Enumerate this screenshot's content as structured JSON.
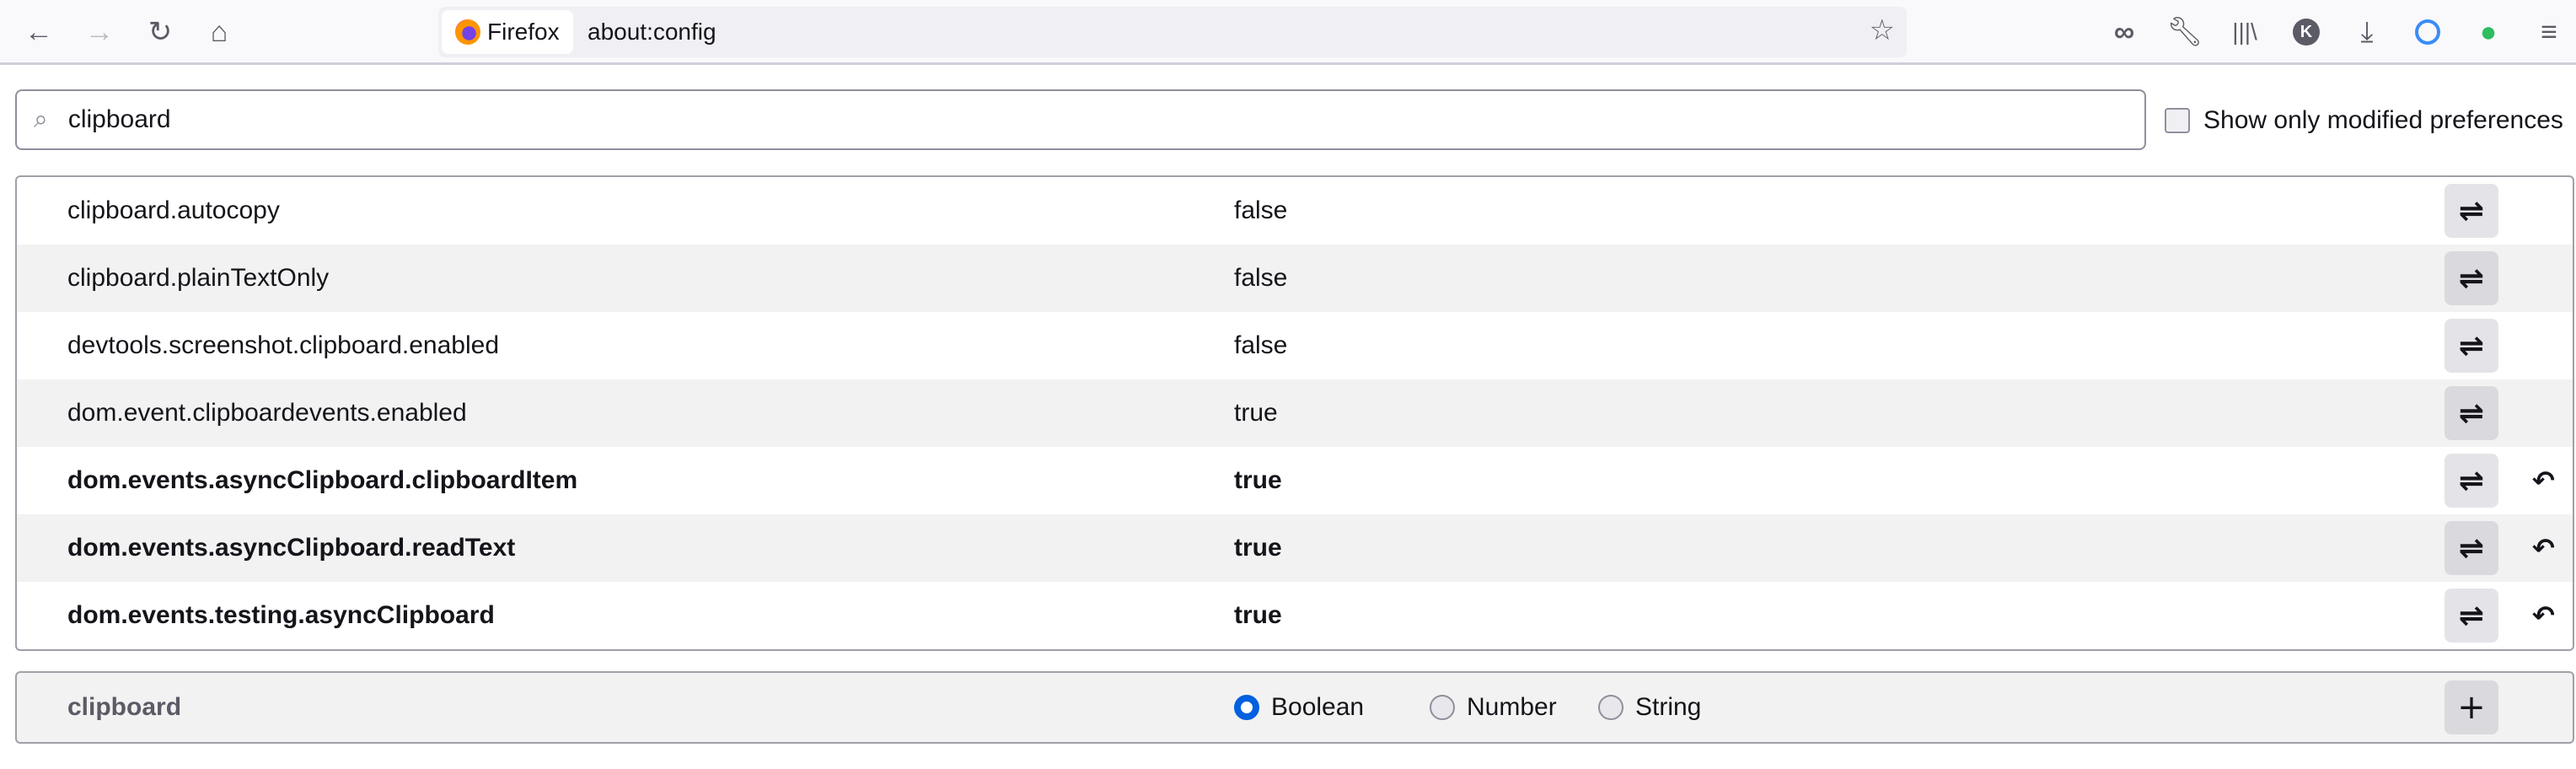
{
  "toolbar": {
    "identity_label": "Firefox",
    "url": "about:config",
    "nav_icons": [
      "back-icon",
      "forward-icon",
      "reload-icon",
      "home-icon"
    ],
    "right_icons": [
      "private-mask-icon",
      "wrench-icon",
      "library-icon",
      "k-extension-icon",
      "download-icon",
      "1password-icon",
      "evernote-icon",
      "menu-icon"
    ],
    "k_label": "K"
  },
  "search": {
    "value": "clipboard"
  },
  "modified_filter": {
    "label": "Show only modified preferences",
    "checked": false
  },
  "prefs": [
    {
      "name": "clipboard.autocopy",
      "value": "false",
      "modified": false
    },
    {
      "name": "clipboard.plainTextOnly",
      "value": "false",
      "modified": false
    },
    {
      "name": "devtools.screenshot.clipboard.enabled",
      "value": "false",
      "modified": false
    },
    {
      "name": "dom.event.clipboardevents.enabled",
      "value": "true",
      "modified": false
    },
    {
      "name": "dom.events.asyncClipboard.clipboardItem",
      "value": "true",
      "modified": true
    },
    {
      "name": "dom.events.asyncClipboard.readText",
      "value": "true",
      "modified": true
    },
    {
      "name": "dom.events.testing.asyncClipboard",
      "value": "true",
      "modified": true
    }
  ],
  "new_pref": {
    "name": "clipboard",
    "types": [
      "Boolean",
      "Number",
      "String"
    ],
    "selected": "Boolean"
  },
  "colors": {
    "accent": "#0060df",
    "evernote": "#2dbe60"
  }
}
